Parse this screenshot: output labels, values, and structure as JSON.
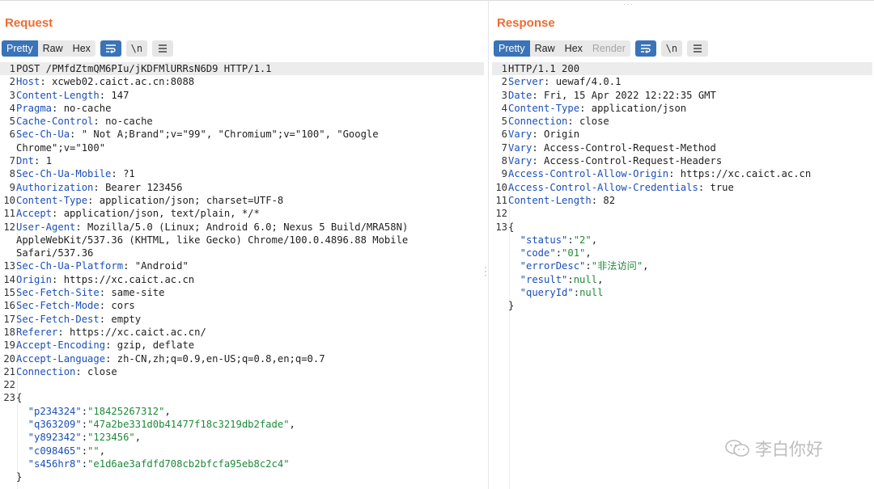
{
  "request": {
    "title": "Request",
    "tabs": [
      "Pretty",
      "Raw",
      "Hex"
    ],
    "active_tab": "Pretty",
    "newline_label": "\\n",
    "lines": [
      {
        "n": "1",
        "t": "POST /PMfdZtmQM6PIu/jKDFMlURRsN6D9 HTTP/1.1"
      },
      {
        "n": "2",
        "k": "Host",
        "v": " xcweb02.caict.ac.cn:8088"
      },
      {
        "n": "3",
        "k": "Content-Length",
        "v": " 147"
      },
      {
        "n": "4",
        "k": "Pragma",
        "v": " no-cache"
      },
      {
        "n": "5",
        "k": "Cache-Control",
        "v": " no-cache"
      },
      {
        "n": "6",
        "k": "Sec-Ch-Ua",
        "v": " \" Not A;Brand\";v=\"99\", \"Chromium\";v=\"100\", \"Google"
      },
      {
        "n": "",
        "t": "Chrome\";v=\"100\""
      },
      {
        "n": "7",
        "k": "Dnt",
        "v": " 1"
      },
      {
        "n": "8",
        "k": "Sec-Ch-Ua-Mobile",
        "v": " ?1"
      },
      {
        "n": "9",
        "k": "Authorization",
        "v": " Bearer 123456"
      },
      {
        "n": "10",
        "k": "Content-Type",
        "v": " application/json; charset=UTF-8"
      },
      {
        "n": "11",
        "k": "Accept",
        "v": " application/json, text/plain, */*"
      },
      {
        "n": "12",
        "k": "User-Agent",
        "v": " Mozilla/5.0 (Linux; Android 6.0; Nexus 5 Build/MRA58N)"
      },
      {
        "n": "",
        "t": "AppleWebKit/537.36 (KHTML, like Gecko) Chrome/100.0.4896.88 Mobile"
      },
      {
        "n": "",
        "t": "Safari/537.36"
      },
      {
        "n": "13",
        "k": "Sec-Ch-Ua-Platform",
        "v": " \"Android\""
      },
      {
        "n": "14",
        "k": "Origin",
        "v": " https://xc.caict.ac.cn"
      },
      {
        "n": "15",
        "k": "Sec-Fetch-Site",
        "v": " same-site"
      },
      {
        "n": "16",
        "k": "Sec-Fetch-Mode",
        "v": " cors"
      },
      {
        "n": "17",
        "k": "Sec-Fetch-Dest",
        "v": " empty"
      },
      {
        "n": "18",
        "k": "Referer",
        "v": " https://xc.caict.ac.cn/"
      },
      {
        "n": "19",
        "k": "Accept-Encoding",
        "v": " gzip, deflate"
      },
      {
        "n": "20",
        "k": "Accept-Language",
        "v": " zh-CN,zh;q=0.9,en-US;q=0.8,en;q=0.7"
      },
      {
        "n": "21",
        "k": "Connection",
        "v": " close"
      },
      {
        "n": "22",
        "t": ""
      },
      {
        "n": "23",
        "t": "{"
      },
      {
        "n": "",
        "jk": "  \"p234324\"",
        "jv": "\"18425267312\"",
        "tail": ","
      },
      {
        "n": "",
        "jk": "  \"q363209\"",
        "jv": "\"47a2be331d0b41477f18c3219db2fade\"",
        "tail": ","
      },
      {
        "n": "",
        "jk": "  \"y892342\"",
        "jv": "\"123456\"",
        "tail": ","
      },
      {
        "n": "",
        "jk": "  \"c098465\"",
        "jv": "\"\"",
        "tail": ","
      },
      {
        "n": "",
        "jk": "  \"s456hr8\"",
        "jv": "\"e1d6ae3afdfd708cb2bfcfa95eb8c2c4\"",
        "tail": ""
      },
      {
        "n": "",
        "t": "}"
      }
    ]
  },
  "response": {
    "title": "Response",
    "tabs": [
      "Pretty",
      "Raw",
      "Hex",
      "Render"
    ],
    "active_tab": "Pretty",
    "newline_label": "\\n",
    "lines": [
      {
        "n": "1",
        "t": "HTTP/1.1 200"
      },
      {
        "n": "2",
        "k": "Server",
        "v": " uewaf/4.0.1"
      },
      {
        "n": "3",
        "k": "Date",
        "v": " Fri, 15 Apr 2022 12:22:35 GMT"
      },
      {
        "n": "4",
        "k": "Content-Type",
        "v": " application/json"
      },
      {
        "n": "5",
        "k": "Connection",
        "v": " close"
      },
      {
        "n": "6",
        "k": "Vary",
        "v": " Origin"
      },
      {
        "n": "7",
        "k": "Vary",
        "v": " Access-Control-Request-Method"
      },
      {
        "n": "8",
        "k": "Vary",
        "v": " Access-Control-Request-Headers"
      },
      {
        "n": "9",
        "k": "Access-Control-Allow-Origin",
        "v": " https://xc.caict.ac.cn"
      },
      {
        "n": "10",
        "k": "Access-Control-Allow-Credentials",
        "v": " true"
      },
      {
        "n": "11",
        "k": "Content-Length",
        "v": " 82"
      },
      {
        "n": "12",
        "t": ""
      },
      {
        "n": "13",
        "t": "{"
      },
      {
        "n": "",
        "jk": "  \"status\"",
        "jv": "\"2\"",
        "tail": ","
      },
      {
        "n": "",
        "jk": "  \"code\"",
        "jv": "\"01\"",
        "tail": ","
      },
      {
        "n": "",
        "jk": "  \"errorDesc\"",
        "jv": "\"非法访问\"",
        "tail": ","
      },
      {
        "n": "",
        "jk": "  \"result\"",
        "jv": "null",
        "tail": ","
      },
      {
        "n": "",
        "jk": "  \"queryId\"",
        "jv": "null",
        "tail": ""
      },
      {
        "n": "",
        "t": "}"
      }
    ]
  },
  "watermark": {
    "text": "李白你好",
    "icon": "wechat-icon"
  },
  "colors": {
    "accent": "#f26b2e",
    "active_tab": "#3a73b7",
    "header_name": "#1b4fb8",
    "json_value": "#1f8a3b"
  }
}
